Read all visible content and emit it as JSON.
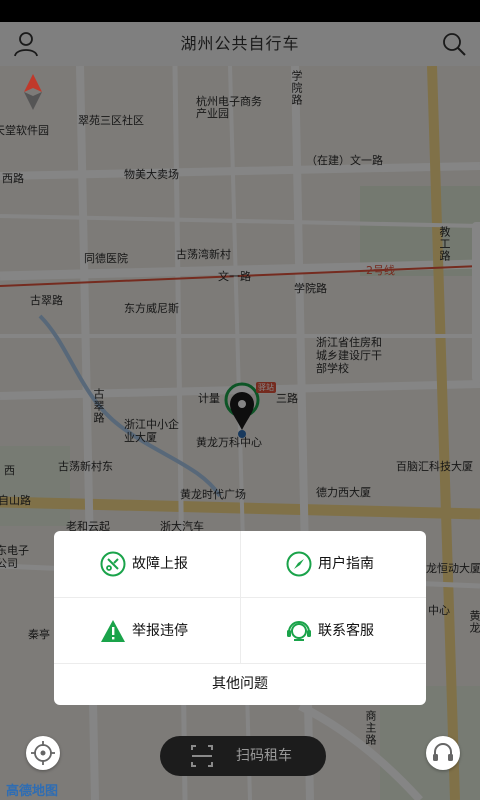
{
  "app": {
    "title": "湖州公共自行车"
  },
  "map": {
    "labels": [
      "学院路",
      "杭州电子商务产业园",
      "翠苑三区社区",
      "天堂软件园",
      "西路",
      "（在建）文一路",
      "物美大卖场",
      "教工路",
      "同德医院",
      "古荡湾新村",
      "文一路",
      "2号线",
      "古翠路",
      "东方威尼斯",
      "学院路",
      "浙江省住房和城乡建设厅干部学校",
      "计量",
      "三路",
      "古翠路",
      "浙江中小企业大厦",
      "黄龙万科中心",
      "西",
      "古荡新村东",
      "百脑汇科技大厦",
      "德力西大厦",
      "黄龙时代广场",
      "自山路",
      "老和云起",
      "浙大汽车",
      "东电子公司",
      "秦亭",
      "龙恒动大厦",
      "中心",
      "黄龙",
      "商主路"
    ],
    "marker_badge": "驿站"
  },
  "menu": {
    "report_fault": "故障上报",
    "user_guide": "用户指南",
    "report_parking": "举报违停",
    "contact_service": "联系客服",
    "other_issues": "其他问题"
  },
  "bottom": {
    "scan_label": "扫码租车",
    "map_provider": "高德地图"
  },
  "colors": {
    "accent_green": "#1aa34a",
    "overlay": "rgba(0,0,0,0.48)",
    "metro_line": "#e0533d"
  }
}
